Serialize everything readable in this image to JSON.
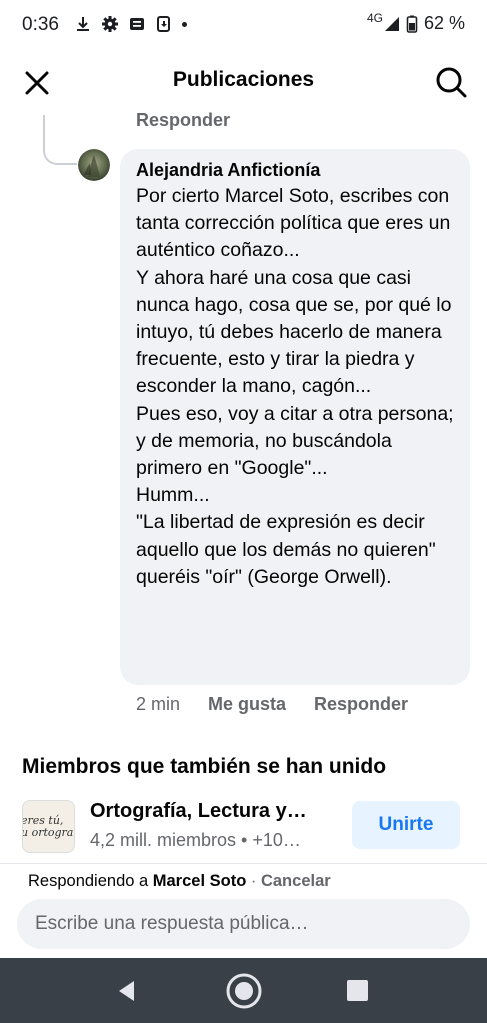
{
  "status_bar": {
    "time": "0:36",
    "network": "4G",
    "battery": "62 %"
  },
  "header": {
    "title": "Publicaciones"
  },
  "previous_reply": {
    "reply_label": "Responder"
  },
  "comment": {
    "author": "Alejandria Anfictionía",
    "text": "Por cierto Marcel Soto, escribes con tanta corrección política que eres un auténtico coñazo...\nY ahora haré una cosa que casi nunca hago, cosa que se, por qué lo intuyo, tú debes hacerlo de manera frecuente, esto y tirar la piedra y esconder la mano, cagón...\nPues eso, voy a citar a otra persona; y de memoria, no buscándola primero en \"Google\"...\nHumm...\n\"La libertad de expresión es decir aquello que los demás no quieren\" queréis \"oír\" (George Orwell).",
    "time": "2 min",
    "like_label": "Me gusta",
    "reply_label": "Responder"
  },
  "suggestions": {
    "title": "Miembros que también se han unido",
    "group": {
      "name": "Ortografía, Lectura y…",
      "info": "4,2 mill. miembros • +10…",
      "thumb_text_1": "eres tú,",
      "thumb_text_2": "u ortogra",
      "join_label": "Unirte"
    }
  },
  "reply_bar": {
    "prefix": "Respondiendo a ",
    "name": "Marcel Soto",
    "separator": " · ",
    "cancel_label": "Cancelar",
    "placeholder": "Escribe una respuesta pública…"
  },
  "colors": {
    "accent": "#1877f2",
    "bubble": "#f0f2f5",
    "secondary_text": "#65676b",
    "nav_bar": "#3a4047"
  },
  "icons": [
    "download-icon",
    "gear-icon",
    "news-icon",
    "cast-icon",
    "signal-icon",
    "battery-icon",
    "close-icon",
    "search-icon",
    "back-nav-icon",
    "home-nav-icon",
    "recents-nav-icon"
  ]
}
